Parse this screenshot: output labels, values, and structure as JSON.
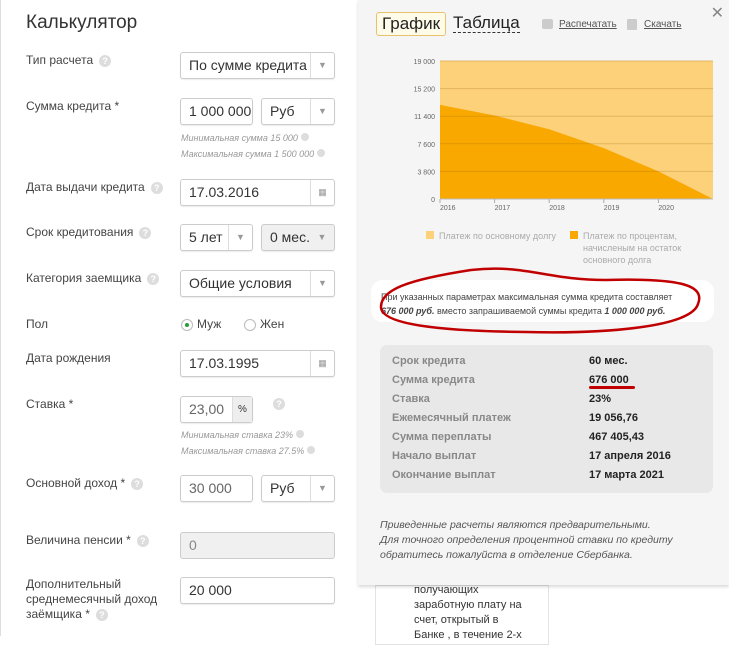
{
  "calculator": {
    "title": "Калькулятор",
    "calc_type": {
      "label": "Тип расчета",
      "value": "По сумме кредита"
    },
    "amount": {
      "label": "Сумма кредита *",
      "value": "1 000 000",
      "currency": "Руб",
      "min_hint": "Минимальная сумма 15 000",
      "max_hint": "Максимальная сумма 1 500 000"
    },
    "issue_date": {
      "label": "Дата выдачи кредита",
      "value": "17.03.2016"
    },
    "term": {
      "label": "Срок кредитования",
      "years": "5 лет",
      "months": "0 мес."
    },
    "category": {
      "label": "Категория заемщика",
      "value": "Общие условия"
    },
    "gender": {
      "label": "Пол",
      "options": [
        "Муж",
        "Жен"
      ],
      "selected": "Муж"
    },
    "birth_date": {
      "label": "Дата рождения",
      "value": "17.03.1995"
    },
    "rate": {
      "label": "Ставка *",
      "value": "23,00",
      "unit": "%",
      "min_hint": "Минимальная ставка 23%",
      "max_hint": "Максимальная ставка 27.5%"
    },
    "income": {
      "label": "Основной доход *",
      "value": "30 000",
      "currency": "Руб"
    },
    "pension": {
      "label": "Величина пенсии *",
      "value": "0"
    },
    "extra_income": {
      "label_lines": [
        "Дополнительный",
        "среднемесячный доход",
        "заёмщика *"
      ],
      "value": "20 000"
    }
  },
  "results": {
    "tabs": [
      "График",
      "Таблица"
    ],
    "active_tab": "График",
    "print_label": "Распечатать",
    "download_label": "Скачать",
    "notice_line1": "При указанных параметрах максимальная сумма кредита составляет",
    "notice_amount": "676 000 руб.",
    "notice_mid": "вместо запрашиваемой суммы кредита",
    "notice_requested": "1 000 000 руб.",
    "summary": [
      {
        "label": "Срок кредита",
        "value": "60 мес."
      },
      {
        "label": "Сумма кредита",
        "value": "676 000"
      },
      {
        "label": "Ставка",
        "value": "23%"
      },
      {
        "label": "Ежемесячный платеж",
        "value": "19 056,76"
      },
      {
        "label": "Сумма переплаты",
        "value": "467 405,43"
      },
      {
        "label": "Начало выплат",
        "value": "17 апреля 2016"
      },
      {
        "label": "Окончание выплат",
        "value": "17 марта 2021"
      }
    ],
    "disclaimer": [
      "Приведенные расчеты являются предварительными.",
      "Для точного определения процентной ставки по кредиту",
      "обратитесь пожалуйста в отделение Сбербанка."
    ],
    "behind_card": [
      "получающих",
      "заработную плату на",
      "счет, открытый в",
      "Банке , в течение 2-х"
    ]
  },
  "chart_data": {
    "type": "area",
    "stacked": true,
    "x": [
      2016,
      2017,
      2018,
      2019,
      2020,
      2021
    ],
    "xticks": [
      "2016",
      "2017",
      "2018",
      "2019",
      "2020"
    ],
    "yticks": [
      "0",
      "3 800",
      "7 600",
      "11 400",
      "15 200",
      "19 000"
    ],
    "ylim": [
      0,
      19000
    ],
    "grid": true,
    "legend_position": "bottom",
    "series": [
      {
        "name": "Платеж по процентам, начисленым на остаток основного долга",
        "values": [
          12957,
          11500,
          9600,
          7000,
          3800,
          0
        ],
        "color": "#f9a800"
      },
      {
        "name": "Платеж по основному долгу",
        "values": [
          6100,
          7557,
          9457,
          12057,
          15257,
          19057
        ],
        "color": "#fdd07a"
      }
    ]
  },
  "colors": {
    "annotation": "#c00000",
    "panel": "#f5f5f5",
    "accent": "#f9a800"
  }
}
